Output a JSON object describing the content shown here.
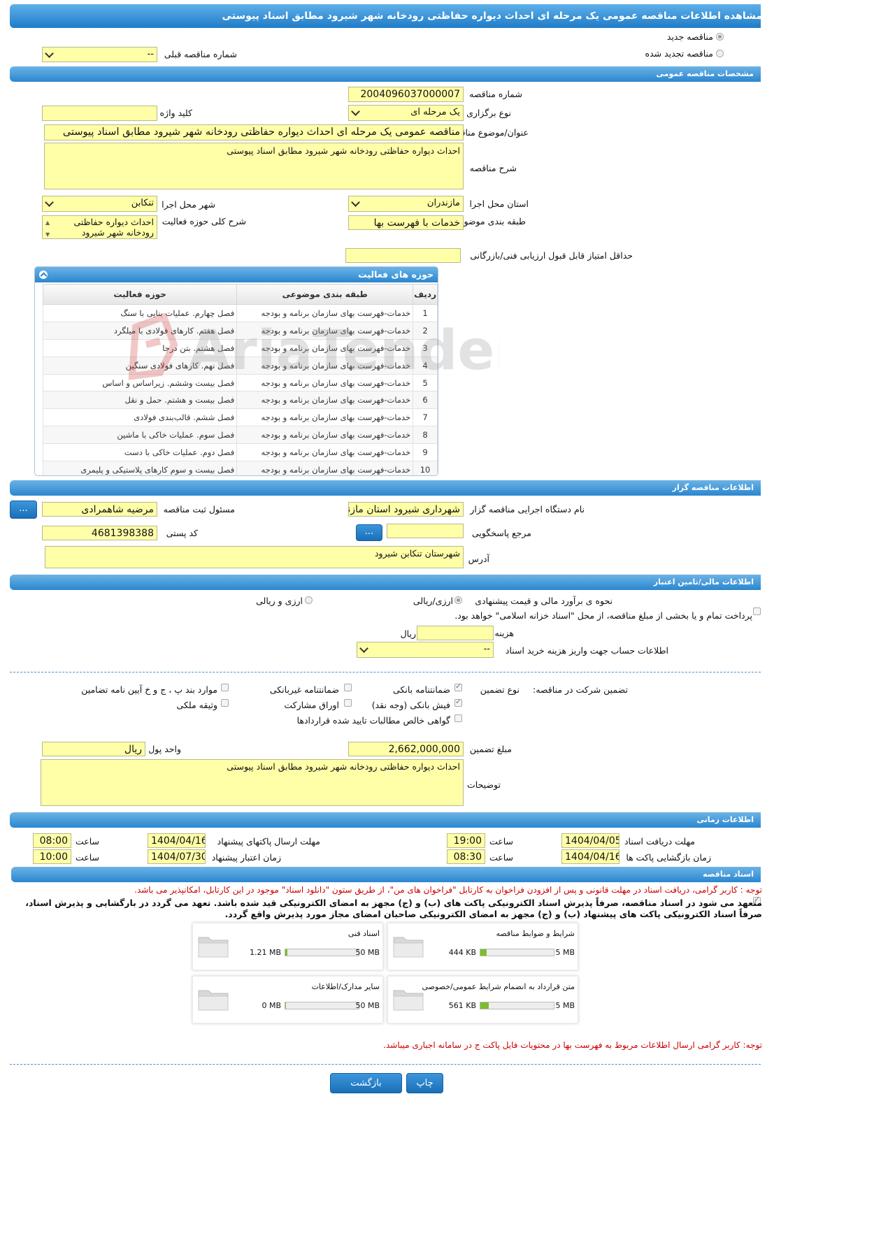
{
  "title": "مشاهده اطلاعات مناقصه عمومی یک مرحله ای احداث دیواره حفاظتی رودخانه شهر شیرود مطابق اسناد پیوستی",
  "top": {
    "radio_new": "مناقصه جدید",
    "radio_renew": "مناقصه تجدید شده",
    "prev_label": "شماره مناقصه قبلی",
    "prev_value": "--"
  },
  "general": {
    "header": "مشخصات مناقصه عمومی",
    "number_label": "شماره مناقصه",
    "number_value": "2004096037000007",
    "type_label": "نوع برگزاری",
    "type_value": "یک مرحله ای",
    "keyword_label": "کلید واژه",
    "keyword_value": "",
    "subject_label": "عنوان/موضوع مناقصه",
    "subject_value": "مناقصه عمومی یک مرحله ای احداث دیواره حفاظتی رودخانه شهر شیرود مطابق اسناد پیوستی",
    "desc_label": "شرح مناقصه",
    "desc_value": "احداث دیواره حفاظتی رودخانه شهر شیرود مطابق اسناد پیوستی",
    "province_label": "استان محل اجرا",
    "province_value": "مازندران",
    "city_label": "شهر محل اجرا",
    "city_value": "تنکابن",
    "category_label": "طبقه بندی موضوعی",
    "category_value": "خدمات با فهرست بها",
    "scope_label": "شرح کلی حوزه فعالیت",
    "scope_value": "احداث دیواره حفاظتی رودخانه شهر شیرود",
    "minscore_label": "حداقل امتیاز قابل قبول ارزیابی فنی/بازرگانی",
    "minscore_value": ""
  },
  "activity": {
    "header": "حوزه های فعالیت",
    "col_row": "ردیف",
    "col_cat": "طبقه بندی موضوعی",
    "col_field": "حوزه فعالیت",
    "rows": [
      {
        "n": "1",
        "cat": "خدمات-فهرست بهای سازمان برنامه و بودجه",
        "field": "فصل چهارم. عملیات بنایی با سنگ"
      },
      {
        "n": "2",
        "cat": "خدمات-فهرست بهای سازمان برنامه و بودجه",
        "field": "فصل هفتم. کارهای فولادی با میلگرد"
      },
      {
        "n": "3",
        "cat": "خدمات-فهرست بهای سازمان برنامه و بودجه",
        "field": "فصل هشتم. بتن درجا"
      },
      {
        "n": "4",
        "cat": "خدمات-فهرست بهای سازمان برنامه و بودجه",
        "field": "فصل نهم. کارهای فولادی سنگین"
      },
      {
        "n": "5",
        "cat": "خدمات-فهرست بهای سازمان برنامه و بودجه",
        "field": "فصل بیست وششم. زیراساس و اساس"
      },
      {
        "n": "6",
        "cat": "خدمات-فهرست بهای سازمان برنامه و بودجه",
        "field": "فصل بیست و هشتم. حمل و نقل"
      },
      {
        "n": "7",
        "cat": "خدمات-فهرست بهای سازمان برنامه و بودجه",
        "field": "فصل ششم. قالب‌بندی فولادی"
      },
      {
        "n": "8",
        "cat": "خدمات-فهرست بهای سازمان برنامه و بودجه",
        "field": "فصل سوم. عملیات خاکی با ماشین"
      },
      {
        "n": "9",
        "cat": "خدمات-فهرست بهای سازمان برنامه و بودجه",
        "field": "فصل دوم. عملیات خاکی با دست"
      },
      {
        "n": "10",
        "cat": "خدمات-فهرست بهای سازمان برنامه و بودجه",
        "field": "فصل بیست و سوم کارهای پلاستیکی و پلیمری"
      }
    ]
  },
  "organizer": {
    "header": "اطلاعات مناقصه گزار",
    "org_label": "نام دستگاه اجرایی مناقصه گزار",
    "org_value": "شهرداری شیرود استان مازندران",
    "resp_label": "مسئول ثبت مناقصه",
    "resp_value": "مرضیه شاهمرادی",
    "ref_label": "مرجع پاسخگویی",
    "ref_value": "",
    "postal_label": "کد پستی",
    "postal_value": "4681398388",
    "address_label": "آدرس",
    "address_value": "شهرستان تنکابن  شیرود",
    "dots": "..."
  },
  "finance": {
    "header": "اطلاعات مالی/تامین اعتبار",
    "estimate_label": "نحوه ی برآورد مالی و قیمت پیشنهادی",
    "opt_rial": "ارزی/ریالی",
    "opt_fx": "ارزی و ریالی",
    "treasury_text": "پرداخت تمام و یا بخشی از مبلغ مناقصه، از محل \"اسناد خزانه اسلامی\" خواهد بود.",
    "doc_fee_label": "هزینه خرید اسناد",
    "doc_fee_value": "",
    "doc_fee_unit": "ریال",
    "account_label": "اطلاعات حساب جهت واریز هزینه خرید اسناد",
    "account_value": "--"
  },
  "guarantee": {
    "label": "تضمین شرکت در مناقصه:",
    "type_label": "نوع تضمین",
    "opts": {
      "bank_guarantee": "ضمانتنامه بانکی",
      "nonbank_guarantee": "ضمانتنامه غیربانکی",
      "clause_items": "موارد بند پ ، ج و خ آیین نامه تضامین",
      "bank_receipt": "فیش بانکی (وجه نقد)",
      "bonds": "اوراق مشارکت",
      "property": "وثیقه ملکی",
      "claims": "گواهی خالص مطالبات تایید شده قراردادها"
    },
    "amount_label": "مبلغ تضمین",
    "amount_value": "2,662,000,000",
    "currency_label": "واحد پول",
    "currency_value": "ریال",
    "notes_label": "توضیحات",
    "notes_value": "احداث دیواره حفاظتی رودخانه شهر شیرود مطابق اسناد پیوستی"
  },
  "timing": {
    "header": "اطلاعات زمانی",
    "doc_receive_label": "مهلت دریافت اسناد",
    "doc_receive_date": "1404/04/05",
    "doc_receive_time": "19:00",
    "send_label": "مهلت ارسال پاکتهای پیشنهاد",
    "send_date": "1404/04/16",
    "send_time": "08:00",
    "open_label": "زمان بازگشایی پاکت ها",
    "open_date": "1404/04/16",
    "open_time": "08:30",
    "valid_label": "زمان اعتبار پیشنهاد",
    "valid_date": "1404/07/30",
    "valid_time": "10:00",
    "time_label": "ساعت"
  },
  "documents": {
    "header": "اسناد مناقصه",
    "note1": "توجه : کاربر گرامی، دریافت اسناد در مهلت قانونی و پس از افزودن فراخوان به کارتابل \"فراخوان های من\"، از طریق ستون \"دانلود اسناد\" موجود در این کارتابل، امکانپذیر می باشد.",
    "commit_line1": "متعهد می شود در اسناد مناقصه، صرفاً پذیرش اسناد الکترونیکی پاکت های (ب) و (ج) مجهز به امضای الکترونیکی قید شده باشد. تعهد می گردد در بارگشایی و پذیرش اسناد،",
    "commit_line2": "صرفاً اسناد الکترونیکی پاکت های پیشنهاد (ب) و (ج) مجهز به امضای الکترونیکی صاحبان امضای مجاز مورد پذیرش واقع گردد.",
    "files": [
      {
        "name": "شرایط و ضوابط مناقصه",
        "size": "444 KB",
        "max": "5 MB",
        "fill": 0.087
      },
      {
        "name": "اسناد فنی",
        "size": "1.21 MB",
        "max": "50 MB",
        "fill": 0.024
      },
      {
        "name": "متن قرارداد به انضمام شرایط عمومی/خصوصی",
        "size": "561 KB",
        "max": "5 MB",
        "fill": 0.11
      },
      {
        "name": "سایر مدارک/اطلاعات",
        "size": "0 MB",
        "max": "50 MB",
        "fill": 0.0
      }
    ],
    "note2": "توجه: کاربر گرامی ارسال اطلاعات مربوط به فهرست بها در محتویات فایل پاکت ج در سامانه اجباری میباشد."
  },
  "buttons": {
    "print": "چاپ",
    "back": "بازگشت"
  },
  "watermark": "AriaTender.neT",
  "colors": {
    "field_bg": "#ffffa8",
    "header_blue": "#2b86cf",
    "warning_red": "#cc0000"
  }
}
